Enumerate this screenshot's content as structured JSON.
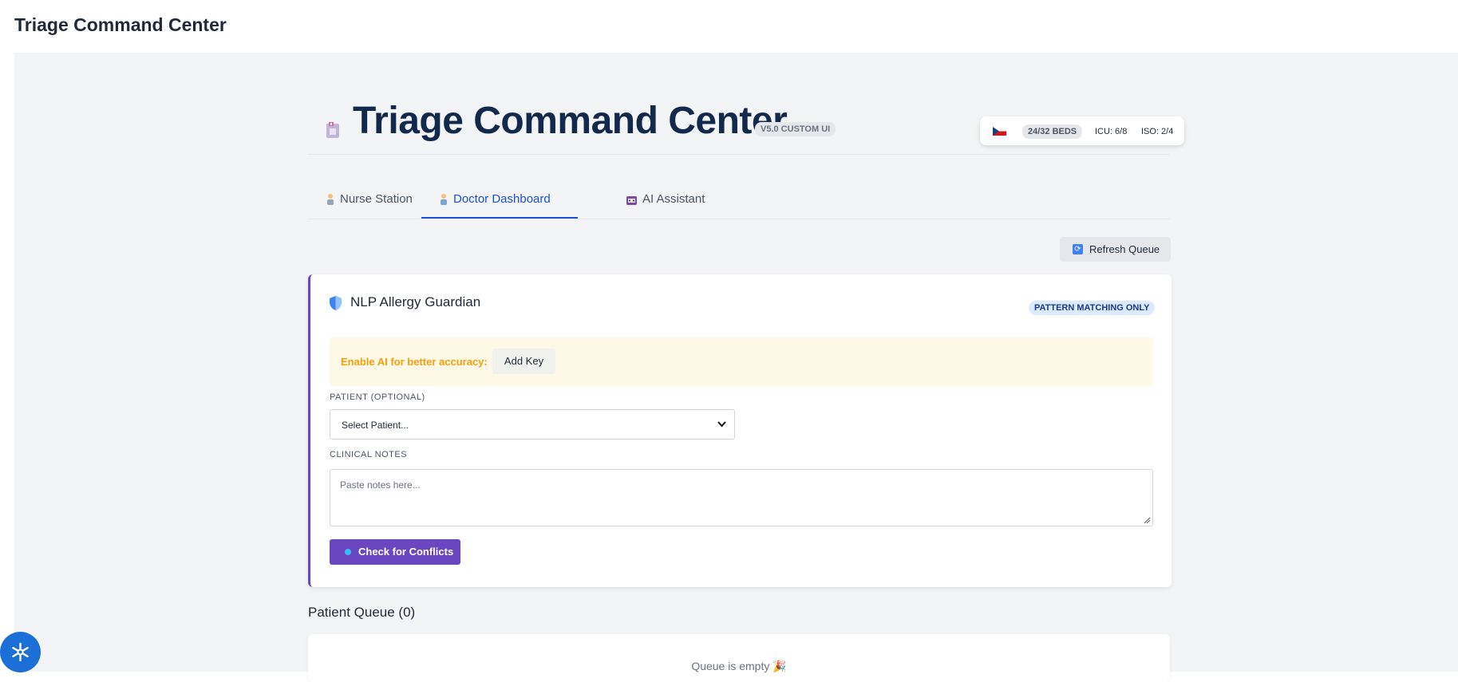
{
  "app": {
    "title": "Triage Command Center"
  },
  "header": {
    "title": "Triage Command Center",
    "version_badge": "V5.0 CUSTOM UI",
    "stats": {
      "beds": "24/32 BEDS",
      "icu": "ICU: 6/8",
      "iso": "ISO: 2/4"
    }
  },
  "tabs": [
    {
      "label": "Nurse Station",
      "icon": "nurse-icon",
      "active": false
    },
    {
      "label": "Doctor Dashboard",
      "icon": "doctor-icon",
      "active": true
    },
    {
      "label": "AI Assistant",
      "icon": "robot-icon",
      "active": false
    }
  ],
  "toolbar": {
    "refresh_label": "Refresh Queue"
  },
  "allergy_guardian": {
    "title": "NLP Allergy Guardian",
    "mode_badge": "PATTERN MATCHING ONLY",
    "ai_prompt": "Enable AI for better accuracy:",
    "add_key_label": "Add Key",
    "patient_label": "PATIENT (OPTIONAL)",
    "patient_select_value": "Select Patient...",
    "notes_label": "CLINICAL NOTES",
    "notes_placeholder": "Paste notes here...",
    "check_button_label": "Check for Conflicts"
  },
  "queue": {
    "title": "Patient Queue (0)",
    "empty_text": "Queue is empty 🎉"
  },
  "colors": {
    "accent_blue": "#1d4ed8",
    "accent_purple": "#6b46c1",
    "title_navy": "#13294b",
    "warning_amber": "#f59e0b"
  }
}
